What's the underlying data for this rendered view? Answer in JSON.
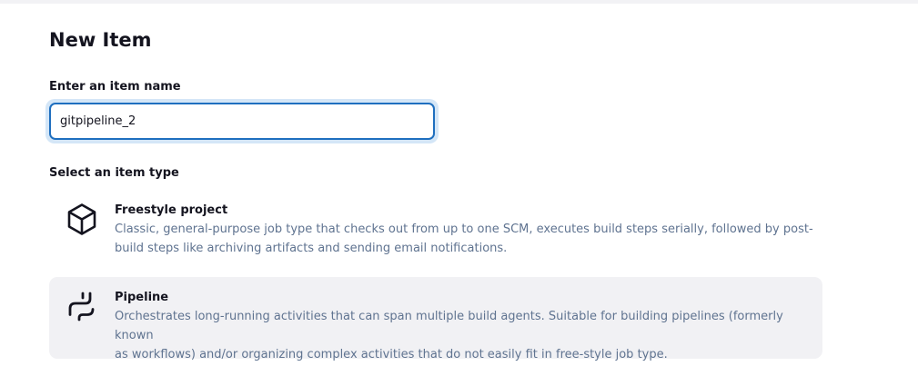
{
  "page": {
    "title": "New Item"
  },
  "name_field": {
    "label": "Enter an item name",
    "value": "gitpipeline_2"
  },
  "item_types": {
    "label": "Select an item type",
    "items": [
      {
        "name": "Freestyle project",
        "description_line1": "Classic, general-purpose job type that checks out from up to one SCM, executes build steps serially, followed by post-",
        "description_line2": "build steps like archiving artifacts and sending email notifications.",
        "icon": "cube-icon",
        "selected": false
      },
      {
        "name": "Pipeline",
        "description_line1": "Orchestrates long-running activities that can span multiple build agents. Suitable for building pipelines (formerly known",
        "description_line2": "as workflows) and/or organizing complex activities that do not easily fit in free-style job type.",
        "icon": "pipeline-icon",
        "selected": true
      }
    ]
  },
  "colors": {
    "selected_background": "#f1f1f4",
    "input_focus_border": "#1f6fbf",
    "description_text": "#5f7390"
  }
}
